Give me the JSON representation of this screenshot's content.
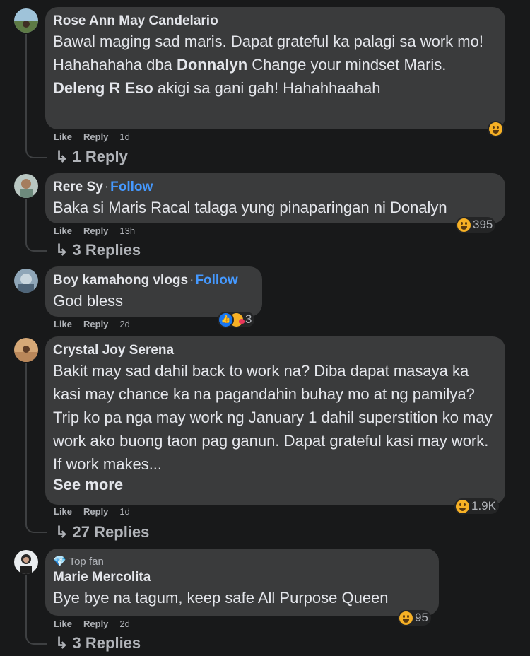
{
  "comments": [
    {
      "name": "Rose Ann May Candelario",
      "text_parts": [
        "Bawal maging sad maris. Dapat grateful ka palagi sa work mo! Hahahahaha dba ",
        "Donnalyn",
        " Change your mindset Maris. ",
        "Deleng R Eso",
        " akigi sa gani gah! Hahahhaahah"
      ],
      "like": "Like",
      "reply": "Reply",
      "time": "1d",
      "replies": "1 Reply"
    },
    {
      "name": "Rere Sy",
      "follow": "Follow",
      "dot": "·",
      "text": "Baka si Maris Racal talaga yung pinaparingan ni Donalyn",
      "like": "Like",
      "reply": "Reply",
      "time": "13h",
      "reaction_count": "395",
      "replies": "3 Replies"
    },
    {
      "name": "Boy kamahong vlogs",
      "follow": "Follow",
      "dot": "·",
      "text": "God bless",
      "like": "Like",
      "reply": "Reply",
      "time": "2d",
      "reaction_count": "3"
    },
    {
      "name": "Crystal Joy Serena",
      "text": "Bakit may sad dahil back to work na? Diba dapat masaya ka kasi may chance ka na pagandahin buhay mo at ng pamilya? Trip ko pa nga may work ng January 1 dahil superstition ko may work ako buong taon pag ganun. Dapat grateful kasi may work. If work makes...",
      "see_more": "See more",
      "like": "Like",
      "reply": "Reply",
      "time": "1d",
      "reaction_count": "1.9K",
      "replies": "27 Replies"
    },
    {
      "badge": "Top fan",
      "name": "Marie Mercolita",
      "text": "Bye bye na tagum, keep safe All Purpose Queen",
      "like": "Like",
      "reply": "Reply",
      "time": "2d",
      "reaction_count": "95",
      "replies": "3 Replies"
    }
  ],
  "colors": {
    "background": "#18191a",
    "bubble": "#3a3b3c",
    "link": "#4599ff",
    "muted": "#b0b3b8"
  }
}
